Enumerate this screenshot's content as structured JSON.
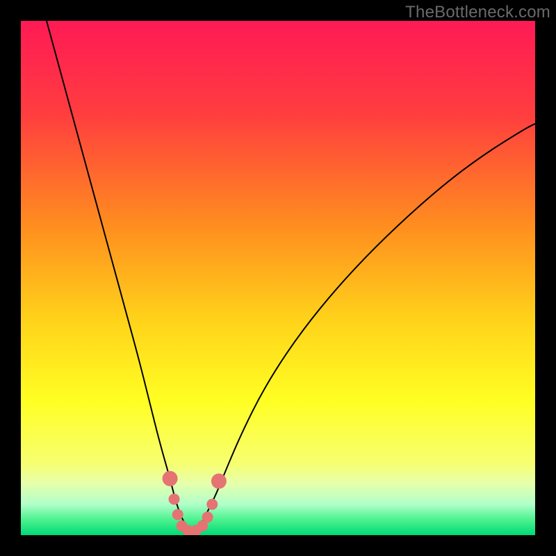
{
  "watermark": "TheBottleneck.com",
  "chart_data": {
    "type": "line",
    "title": "",
    "xlabel": "",
    "ylabel": "",
    "xlim": [
      0,
      100
    ],
    "ylim": [
      0,
      100
    ],
    "grid": false,
    "legend": false,
    "background_gradient": {
      "stops": [
        {
          "offset": 0.0,
          "color": "#ff1a55"
        },
        {
          "offset": 0.18,
          "color": "#ff3d3f"
        },
        {
          "offset": 0.4,
          "color": "#ff8e1f"
        },
        {
          "offset": 0.58,
          "color": "#ffd21a"
        },
        {
          "offset": 0.74,
          "color": "#ffff23"
        },
        {
          "offset": 0.86,
          "color": "#f7ff70"
        },
        {
          "offset": 0.9,
          "color": "#e6ffad"
        },
        {
          "offset": 0.94,
          "color": "#b0ffc9"
        },
        {
          "offset": 0.97,
          "color": "#4bf28e"
        },
        {
          "offset": 1.0,
          "color": "#00d977"
        }
      ]
    },
    "series": [
      {
        "name": "bottleneck-curve",
        "stroke": "#000000",
        "stroke_width": 2,
        "x": [
          5,
          8,
          11,
          14,
          17,
          20,
          23,
          25,
          27,
          29,
          30,
          31,
          32,
          33,
          34,
          35,
          36,
          38,
          40,
          43,
          47,
          52,
          58,
          65,
          73,
          82,
          90,
          98,
          100
        ],
        "y": [
          100,
          89,
          78,
          67,
          56,
          45,
          34,
          26,
          18,
          11,
          7,
          4,
          2,
          1,
          1,
          2,
          4,
          8,
          13,
          20,
          28,
          36,
          44,
          52,
          60,
          68,
          74,
          79,
          80
        ]
      }
    ],
    "markers": {
      "name": "highlight-dots",
      "color": "#e57373",
      "radius_large": 11,
      "radius_small": 8,
      "points": [
        {
          "x": 29.0,
          "y": 11.0,
          "r": "large"
        },
        {
          "x": 29.8,
          "y": 7.0,
          "r": "small"
        },
        {
          "x": 30.5,
          "y": 4.0,
          "r": "small"
        },
        {
          "x": 31.3,
          "y": 1.8,
          "r": "small"
        },
        {
          "x": 32.5,
          "y": 0.9,
          "r": "small"
        },
        {
          "x": 34.0,
          "y": 0.9,
          "r": "small"
        },
        {
          "x": 35.3,
          "y": 1.8,
          "r": "small"
        },
        {
          "x": 36.3,
          "y": 3.5,
          "r": "small"
        },
        {
          "x": 37.2,
          "y": 6.0,
          "r": "small"
        },
        {
          "x": 38.5,
          "y": 10.5,
          "r": "large"
        }
      ]
    }
  }
}
